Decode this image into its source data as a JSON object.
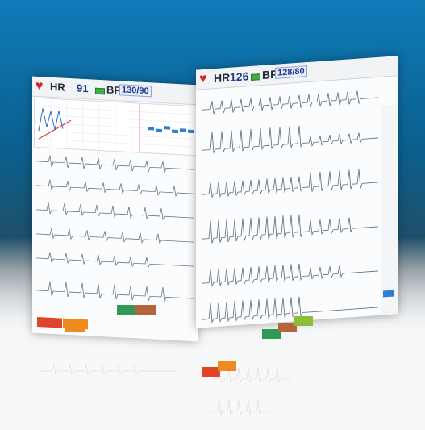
{
  "left_monitor": {
    "hr_label": "HR",
    "hr_value": "91",
    "bp_label": "BP",
    "bp_value": "130/90"
  },
  "right_monitor": {
    "hr_label": "HR",
    "hr_value": "126",
    "bp_label": "BP",
    "bp_value": "128/80"
  },
  "colors": {
    "accent_blue": "#1e3a8a",
    "heart_red": "#d9262b",
    "battery_green": "#3fae49",
    "btn_orange": "#f08a1e",
    "btn_red": "#e0452b",
    "btn_green": "#2f9a57",
    "btn_brown": "#b5653a",
    "btn_lime": "#8bbf3a",
    "btn_blue": "#2f7fcf"
  }
}
